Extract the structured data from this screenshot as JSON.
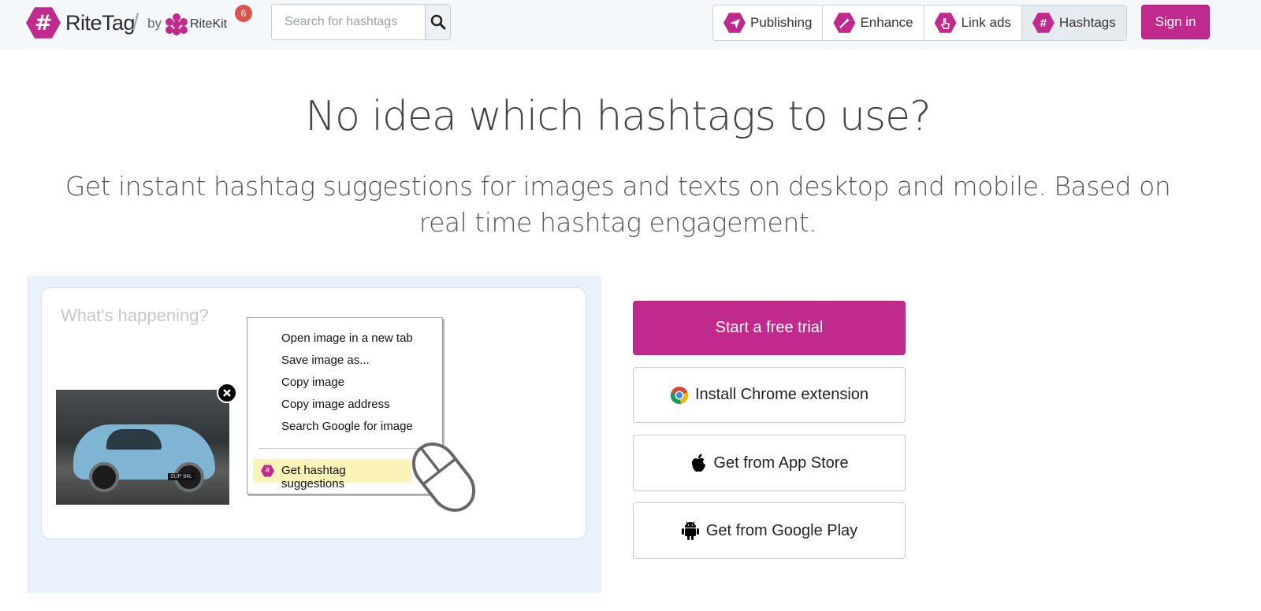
{
  "header": {
    "brand": "RiteTag",
    "slash": "/",
    "by": "by",
    "parent_brand": "RiteKit",
    "notification_count": "6",
    "logo_symbol": "#",
    "search": {
      "placeholder": "Search for hashtags"
    },
    "nav": [
      {
        "label": "Publishing",
        "icon": "paper-plane-icon"
      },
      {
        "label": "Enhance",
        "icon": "magic-wand-icon"
      },
      {
        "label": "Link ads",
        "icon": "pointer-hand-icon"
      },
      {
        "label": "Hashtags",
        "icon": "hash-icon",
        "active": true
      }
    ],
    "sign_in": "Sign in"
  },
  "hero": {
    "title": "No idea which hashtags to use?",
    "subtitle": "Get instant hashtag suggestions for images and texts on desktop and mobile. Based on real time hashtag engagement."
  },
  "demo": {
    "composer_placeholder": "What's happening?",
    "plate": "SUP 94L",
    "context_menu": [
      "Open image in a new tab",
      "Save image as...",
      "Copy image",
      "Copy image address",
      "Search Google for image"
    ],
    "highlight_item": "Get hashtag suggestions"
  },
  "actions": {
    "trial": "Start a free trial",
    "chrome": "Install Chrome extension",
    "app_store": "Get from App Store",
    "google_play": "Get from Google Play"
  },
  "colors": {
    "accent": "#c02a8c",
    "panel": "#e9f1fb",
    "header_bg": "#f5f8fb",
    "highlight": "#fbf3b7"
  }
}
